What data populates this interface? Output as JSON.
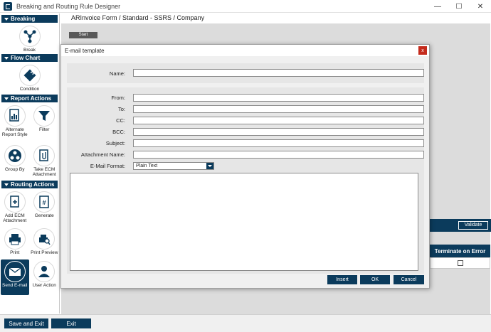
{
  "window": {
    "title": "Breaking and Routing Rule Designer",
    "minimize": "—",
    "maximize": "☐",
    "close": "✕"
  },
  "breadcrumb": "ARInvoice Form / Standard - SSRS / Company",
  "sidebar": {
    "sections": [
      {
        "label": "Breaking"
      },
      {
        "label": "Flow Chart"
      },
      {
        "label": "Report Actions"
      },
      {
        "label": "Routing Actions"
      }
    ],
    "tools": {
      "break": "Break",
      "condition": "Condition",
      "alternate_report_style": "Alternate Report Style",
      "filter": "Filter",
      "group_by": "Group By",
      "take_ecm_attachment": "Take ECM Attachment",
      "add_ecm_attachment": "Add ECM Attachment",
      "generate": "Generate",
      "print": "Print",
      "print_preview": "Print Preview",
      "send_email": "Send E-mail",
      "user_action": "User Action"
    }
  },
  "canvas": {
    "start_node": "Start",
    "validate_button": "Validate",
    "grid_header": "Terminate on Error"
  },
  "modal": {
    "title": "E-mail template",
    "close": "x",
    "fields": {
      "name_label": "Name:",
      "name_value": "",
      "from_label": "From:",
      "from_value": "",
      "to_label": "To:",
      "to_value": "",
      "cc_label": "CC:",
      "cc_value": "",
      "bcc_label": "BCC:",
      "bcc_value": "",
      "subject_label": "Subject:",
      "subject_value": "",
      "attachment_label": "Attachment Name:",
      "attachment_value": "",
      "format_label": "E-Mail Format:",
      "format_value": "Plain Text"
    },
    "buttons": {
      "insert": "Insert",
      "ok": "OK",
      "cancel": "Cancel"
    }
  },
  "bottom": {
    "save_exit": "Save and Exit",
    "exit": "Exit"
  },
  "colors": {
    "accent": "#0b3b5c",
    "canvas_bg": "#dcdcdc",
    "close_red": "#c42b1c"
  }
}
